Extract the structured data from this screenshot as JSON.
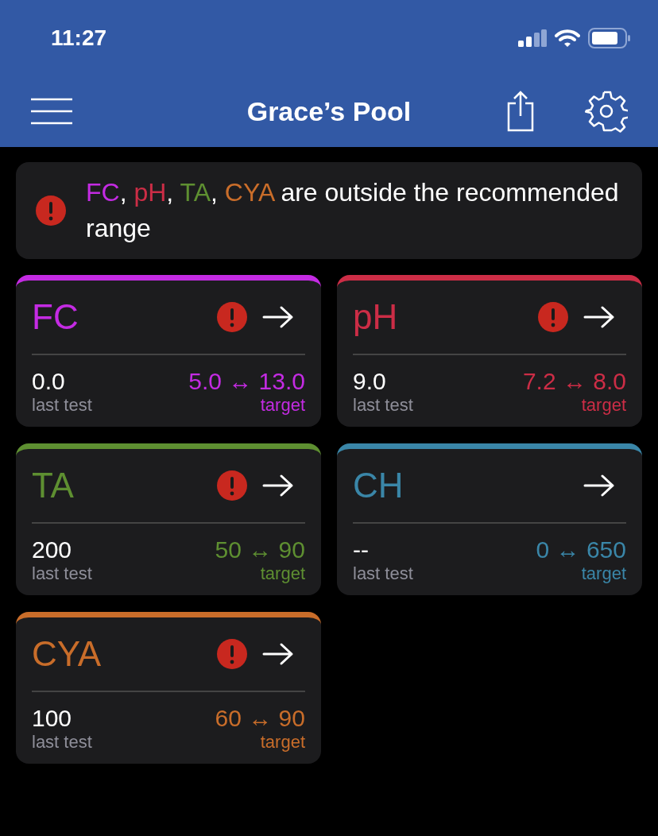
{
  "status_bar": {
    "time": "11:27"
  },
  "nav": {
    "title": "Grace’s Pool"
  },
  "alert": {
    "segments": [
      {
        "text": "FC",
        "color": "#c42be3"
      },
      {
        "text": ", "
      },
      {
        "text": "pH",
        "color": "#cc2d46"
      },
      {
        "text": ", "
      },
      {
        "text": "TA",
        "color": "#5e8f31"
      },
      {
        "text": ", "
      },
      {
        "text": "CYA",
        "color": "#c96d2a"
      },
      {
        "text": " are outside the recommended range"
      }
    ]
  },
  "cards": [
    {
      "name": "FC",
      "color": "#c42be3",
      "alert": true,
      "last_value": "0.0",
      "last_label": "last test",
      "target": "5.0 ↔ 13.0",
      "target_label": "target"
    },
    {
      "name": "pH",
      "color": "#cc2d46",
      "alert": true,
      "last_value": "9.0",
      "last_label": "last test",
      "target": "7.2 ↔ 8.0",
      "target_label": "target"
    },
    {
      "name": "TA",
      "color": "#5e8f31",
      "alert": true,
      "last_value": "200",
      "last_label": "last test",
      "target": "50 ↔ 90",
      "target_label": "target"
    },
    {
      "name": "CH",
      "color": "#3a86a8",
      "alert": false,
      "last_value": "--",
      "last_label": "last test",
      "target": "0 ↔ 650",
      "target_label": "target"
    },
    {
      "name": "CYA",
      "color": "#c96d2a",
      "alert": true,
      "last_value": "100",
      "last_label": "last test",
      "target": "60 ↔ 90",
      "target_label": "target"
    }
  ]
}
